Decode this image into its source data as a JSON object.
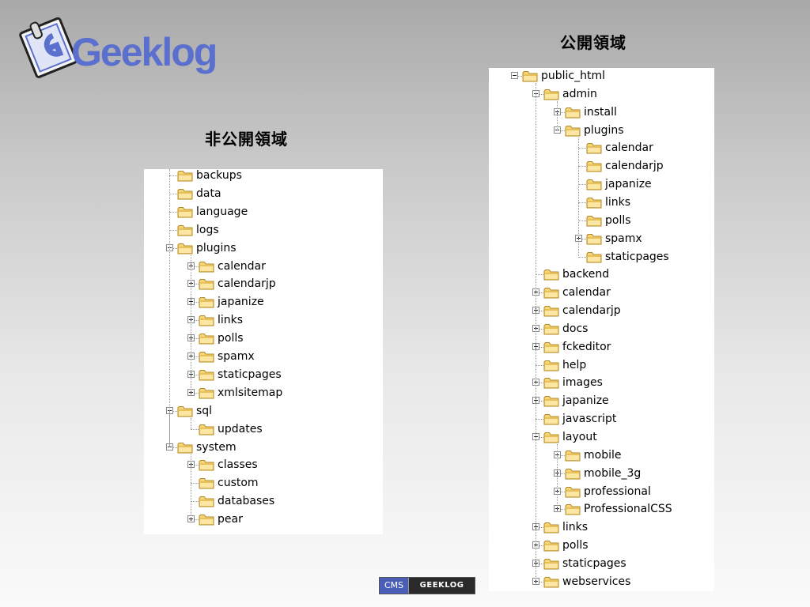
{
  "logo": {
    "text": "Geeklog"
  },
  "headings": {
    "public": "公開領域",
    "nonpublic": "非公開領域"
  },
  "badge": {
    "cms": "CMS",
    "name": "GEEKLOG"
  },
  "tree_left": [
    {
      "label": "backups",
      "depth": 0,
      "toggle": "none"
    },
    {
      "label": "data",
      "depth": 0,
      "toggle": "none"
    },
    {
      "label": "language",
      "depth": 0,
      "toggle": "none"
    },
    {
      "label": "logs",
      "depth": 0,
      "toggle": "none"
    },
    {
      "label": "plugins",
      "depth": 0,
      "toggle": "minus"
    },
    {
      "label": "calendar",
      "depth": 1,
      "toggle": "plus"
    },
    {
      "label": "calendarjp",
      "depth": 1,
      "toggle": "plus"
    },
    {
      "label": "japanize",
      "depth": 1,
      "toggle": "plus"
    },
    {
      "label": "links",
      "depth": 1,
      "toggle": "plus"
    },
    {
      "label": "polls",
      "depth": 1,
      "toggle": "plus"
    },
    {
      "label": "spamx",
      "depth": 1,
      "toggle": "plus"
    },
    {
      "label": "staticpages",
      "depth": 1,
      "toggle": "plus"
    },
    {
      "label": "xmlsitemap",
      "depth": 1,
      "toggle": "plus"
    },
    {
      "label": "sql",
      "depth": 0,
      "toggle": "minus"
    },
    {
      "label": "updates",
      "depth": 1,
      "toggle": "none"
    },
    {
      "label": "system",
      "depth": 0,
      "toggle": "minus"
    },
    {
      "label": "classes",
      "depth": 1,
      "toggle": "plus"
    },
    {
      "label": "custom",
      "depth": 1,
      "toggle": "none"
    },
    {
      "label": "databases",
      "depth": 1,
      "toggle": "none"
    },
    {
      "label": "pear",
      "depth": 1,
      "toggle": "plus"
    }
  ],
  "tree_right": [
    {
      "label": "public_html",
      "depth": 0,
      "toggle": "minus"
    },
    {
      "label": "admin",
      "depth": 1,
      "toggle": "minus"
    },
    {
      "label": "install",
      "depth": 2,
      "toggle": "plus"
    },
    {
      "label": "plugins",
      "depth": 2,
      "toggle": "minus"
    },
    {
      "label": "calendar",
      "depth": 3,
      "toggle": "none"
    },
    {
      "label": "calendarjp",
      "depth": 3,
      "toggle": "none"
    },
    {
      "label": "japanize",
      "depth": 3,
      "toggle": "none"
    },
    {
      "label": "links",
      "depth": 3,
      "toggle": "none"
    },
    {
      "label": "polls",
      "depth": 3,
      "toggle": "none"
    },
    {
      "label": "spamx",
      "depth": 3,
      "toggle": "plus"
    },
    {
      "label": "staticpages",
      "depth": 3,
      "toggle": "none"
    },
    {
      "label": "backend",
      "depth": 1,
      "toggle": "none"
    },
    {
      "label": "calendar",
      "depth": 1,
      "toggle": "plus"
    },
    {
      "label": "calendarjp",
      "depth": 1,
      "toggle": "plus"
    },
    {
      "label": "docs",
      "depth": 1,
      "toggle": "plus"
    },
    {
      "label": "fckeditor",
      "depth": 1,
      "toggle": "plus"
    },
    {
      "label": "help",
      "depth": 1,
      "toggle": "none"
    },
    {
      "label": "images",
      "depth": 1,
      "toggle": "plus"
    },
    {
      "label": "japanize",
      "depth": 1,
      "toggle": "plus"
    },
    {
      "label": "javascript",
      "depth": 1,
      "toggle": "none"
    },
    {
      "label": "layout",
      "depth": 1,
      "toggle": "minus"
    },
    {
      "label": "mobile",
      "depth": 2,
      "toggle": "plus"
    },
    {
      "label": "mobile_3g",
      "depth": 2,
      "toggle": "plus"
    },
    {
      "label": "professional",
      "depth": 2,
      "toggle": "plus"
    },
    {
      "label": "ProfessionalCSS",
      "depth": 2,
      "toggle": "plus"
    },
    {
      "label": "links",
      "depth": 1,
      "toggle": "plus"
    },
    {
      "label": "polls",
      "depth": 1,
      "toggle": "plus"
    },
    {
      "label": "staticpages",
      "depth": 1,
      "toggle": "plus"
    },
    {
      "label": "webservices",
      "depth": 1,
      "toggle": "plus"
    }
  ]
}
